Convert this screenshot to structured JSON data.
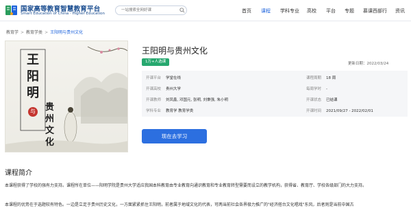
{
  "header": {
    "brand_cn": "国家高等教育智慧教育平台",
    "brand_en": "Smart Education of China · Higher Education",
    "search_placeholder": "一站搜索全网好课",
    "nav": [
      "首页",
      "课程",
      "学科专业",
      "高校",
      "平台",
      "专题",
      "慕课西部行",
      "资讯"
    ],
    "active_nav": "课程"
  },
  "breadcrumb": {
    "items": [
      "教育学",
      "教育学类",
      "王阳明与贵州文化"
    ]
  },
  "course": {
    "cover_title_vertical": "王阳明",
    "cover_conj": "与",
    "cover_title2": "贵州文化",
    "title": "王阳明与贵州文化",
    "badge": "1万+人选课",
    "updated": "更新日期：2022/03/24",
    "info": {
      "platform_label": "开课平台",
      "platform": "学堂在线",
      "school_label": "开课高校",
      "school": "贵州大学",
      "teachers_label": "开课教师",
      "teachers": "刘凤鑫, 邓国元, 张明, 刘秉强, 朱小明",
      "subject_label": "学科专业",
      "subject": "教育学 教育学类",
      "period_label": "课程周期",
      "period": "18 周",
      "hours_label": "每周学时",
      "hours": "-",
      "status_label": "开课状态",
      "status": "已结课",
      "dates_label": "开课时间",
      "dates": "2021/09/27 - 2022/02/01"
    },
    "study_button": "现在去学习"
  },
  "intro": {
    "heading": "课程简介",
    "p1": "本课程获得了学校的强有力支持。课程所在单位——阳明学院是贵州大学适应我国本科教育由专业教育向通识教育和专业教育转型需要而设立的教学机构，获得省、教育厅、学校各级部门的大力支持。",
    "p2": "本课程的优势在于选题较有特色。一边是立足于贵州历史文化，一方面紧紧抓住王阳明，前者属于地域文化的代表，可两当前社会各界极力推广的\"经济搭台文化唱戏\"东风，后者则是当前中国古"
  },
  "colors": {
    "brand": "#1d4f91",
    "accent": "#2c6fe0",
    "badge": "#27a86f"
  }
}
